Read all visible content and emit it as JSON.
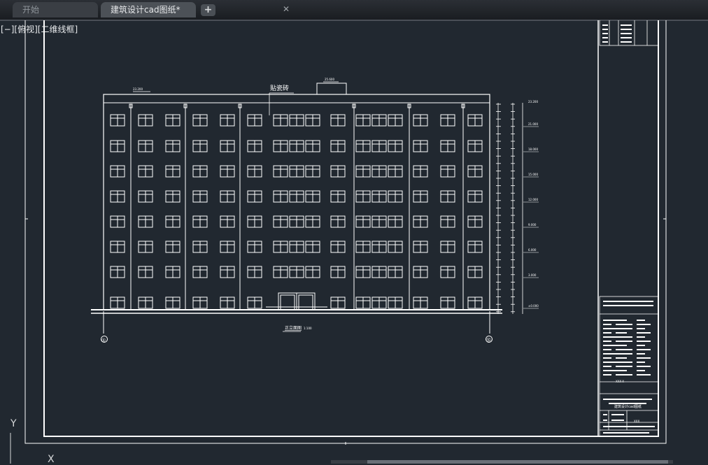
{
  "tabs": [
    {
      "label": "开始"
    },
    {
      "label": "建筑设计cad图纸*"
    }
  ],
  "viewport_label": "[−][俯视][二维线框]",
  "drawing": {
    "facade_caption": "贴瓷砖",
    "drawing_caption": "正立面图",
    "caption_scale": "1:100",
    "axis_left": "①",
    "axis_right": "⑮",
    "top_levels": [
      "23.200",
      "25.600"
    ],
    "level_marks": [
      "21.000",
      "18.000",
      "15.000",
      "12.000",
      "9.000",
      "6.000",
      "3.000",
      "±0.000"
    ],
    "title_block": {
      "drawing_no": "XXX-X",
      "drawing_name": "建筑设计cad图纸",
      "company": "XXX"
    }
  },
  "ucs": {
    "y": "Y",
    "x": "X"
  },
  "colors": {
    "background": "#212830",
    "lines": "#ffffff"
  }
}
